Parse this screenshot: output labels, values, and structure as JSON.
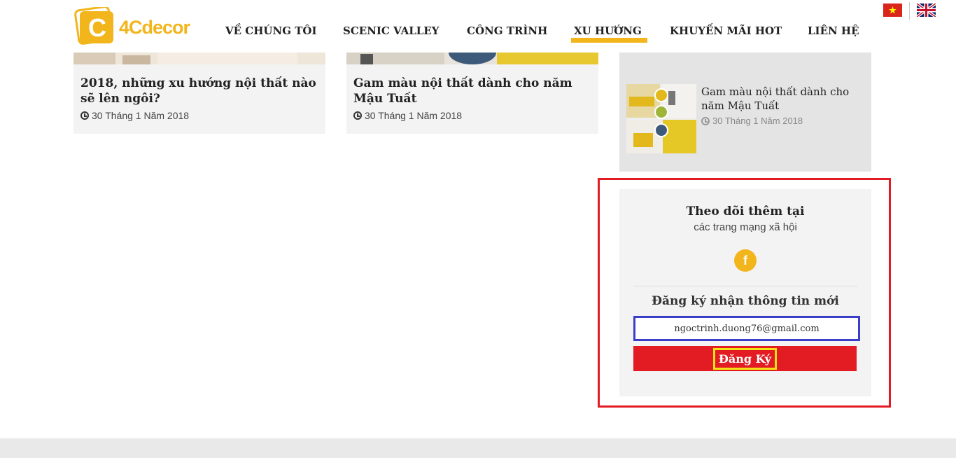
{
  "header": {
    "brand": "4Cdecor",
    "nav": [
      {
        "label": "VỀ CHÚNG TÔI"
      },
      {
        "label": "SCENIC VALLEY"
      },
      {
        "label": "CÔNG TRÌNH"
      },
      {
        "label": "XU HƯỚNG"
      },
      {
        "label": "KHUYẾN MÃI HOT"
      },
      {
        "label": "LIÊN HỆ"
      }
    ],
    "active_nav": "XU HƯỚNG",
    "languages": [
      "vi-flag-icon",
      "uk-flag-icon"
    ]
  },
  "articles": [
    {
      "title": "2018, những xu hướng nội thất nào sẽ lên ngôi?",
      "date": "30 Tháng 1 Năm 2018"
    },
    {
      "title": "Gam màu nội thất dành cho năm Mậu Tuất",
      "date": "30 Tháng 1 Năm 2018"
    }
  ],
  "sidebar": {
    "recent": {
      "title": "Gam màu nội thất dành cho năm Mậu Tuất",
      "date": "30 Tháng 1 Năm 2018"
    },
    "follow": {
      "title": "Theo dõi thêm tại",
      "subtitle": "các trang mạng xã hội",
      "facebook_icon": "f"
    },
    "newsletter": {
      "title": "Đăng ký nhận thông tin mới",
      "email_value": "ngoctrinh.duong76@gmail.com",
      "submit_label": "Đăng Ký"
    }
  },
  "colors": {
    "brand": "#f2b51c",
    "accent_red": "#e31b23",
    "input_border": "#3b3fc7"
  }
}
